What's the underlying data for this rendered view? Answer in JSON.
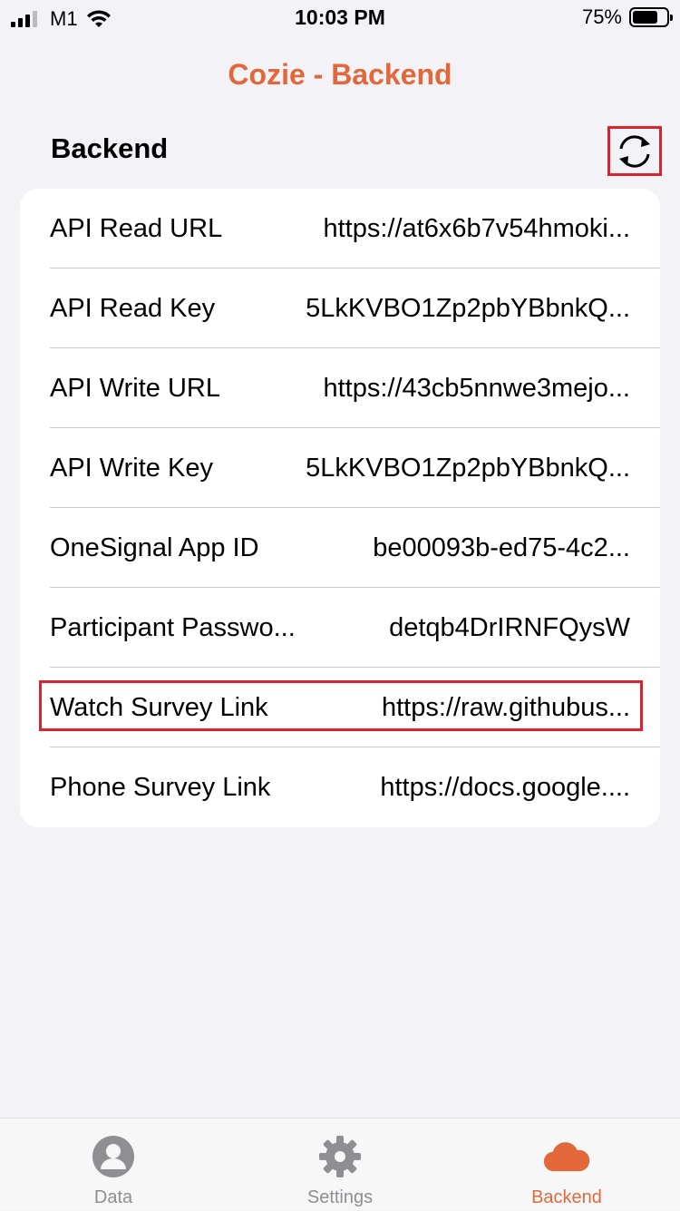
{
  "status_bar": {
    "carrier": "M1",
    "time": "10:03 PM",
    "battery_percent": "75%",
    "battery_level": 0.75
  },
  "nav": {
    "title": "Cozie - Backend"
  },
  "section": {
    "title": "Backend"
  },
  "rows": [
    {
      "label": "API Read URL",
      "value": "https://at6x6b7v54hmoki..."
    },
    {
      "label": "API Read Key",
      "value": "5LkKVBO1Zp2pbYBbnkQ..."
    },
    {
      "label": "API Write URL",
      "value": "https://43cb5nnwe3mejo..."
    },
    {
      "label": "API Write Key",
      "value": "5LkKVBO1Zp2pbYBbnkQ..."
    },
    {
      "label": "OneSignal App ID",
      "value": "be00093b-ed75-4c2..."
    },
    {
      "label": "Participant Passwo...",
      "value": "detqb4DrIRNFQysW"
    },
    {
      "label": "Watch Survey Link",
      "value": "https://raw.githubus..."
    },
    {
      "label": "Phone Survey Link",
      "value": "https://docs.google...."
    }
  ],
  "tabs": [
    {
      "label": "Data",
      "icon": "person-circle-icon"
    },
    {
      "label": "Settings",
      "icon": "gear-icon"
    },
    {
      "label": "Backend",
      "icon": "cloud-icon"
    }
  ],
  "colors": {
    "accent": "#e2673a",
    "highlight": "#d9232e",
    "background": "#f2f2f7",
    "inactive": "#8e8e93"
  }
}
